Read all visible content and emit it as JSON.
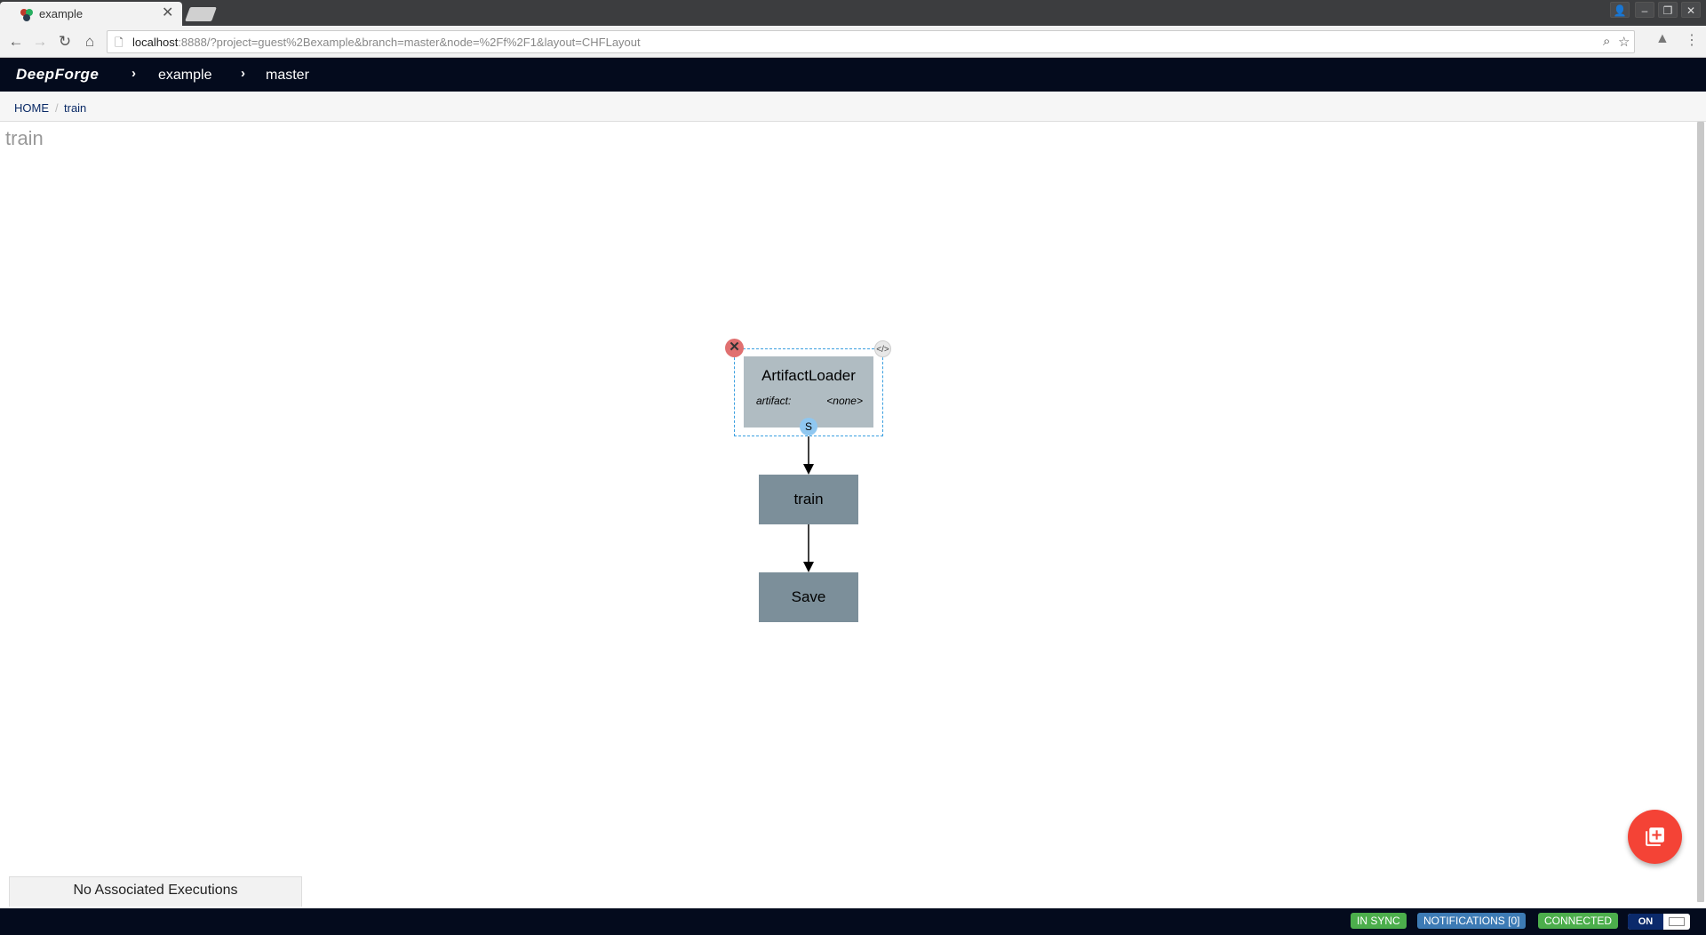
{
  "browser": {
    "tab_title": "example",
    "url_host": "localhost",
    "url_rest": ":8888/?project=guest%2Bexample&branch=master&node=%2Ff%2F1&layout=CHFLayout"
  },
  "app": {
    "brand": "DeepForge",
    "project": "example",
    "branch": "master"
  },
  "nav": {
    "home": "HOME",
    "current": "train"
  },
  "page_title": "train",
  "graph": {
    "nodes": [
      {
        "name": "ArtifactLoader",
        "attr_key": "artifact:",
        "attr_val": "<none>",
        "port": "S"
      },
      {
        "name": "train"
      },
      {
        "name": "Save"
      }
    ]
  },
  "executions": "No Associated Executions",
  "status": {
    "sync": "IN SYNC",
    "notifications": "NOTIFICATIONS [0]",
    "connected": "CONNECTED",
    "toggle": "ON"
  },
  "colors": {
    "header_bg": "#040b1d",
    "node_fill": "#7c8f9a",
    "fab": "#f44336",
    "badge_green": "#4cae4c",
    "badge_blue": "#3d7bb5"
  }
}
